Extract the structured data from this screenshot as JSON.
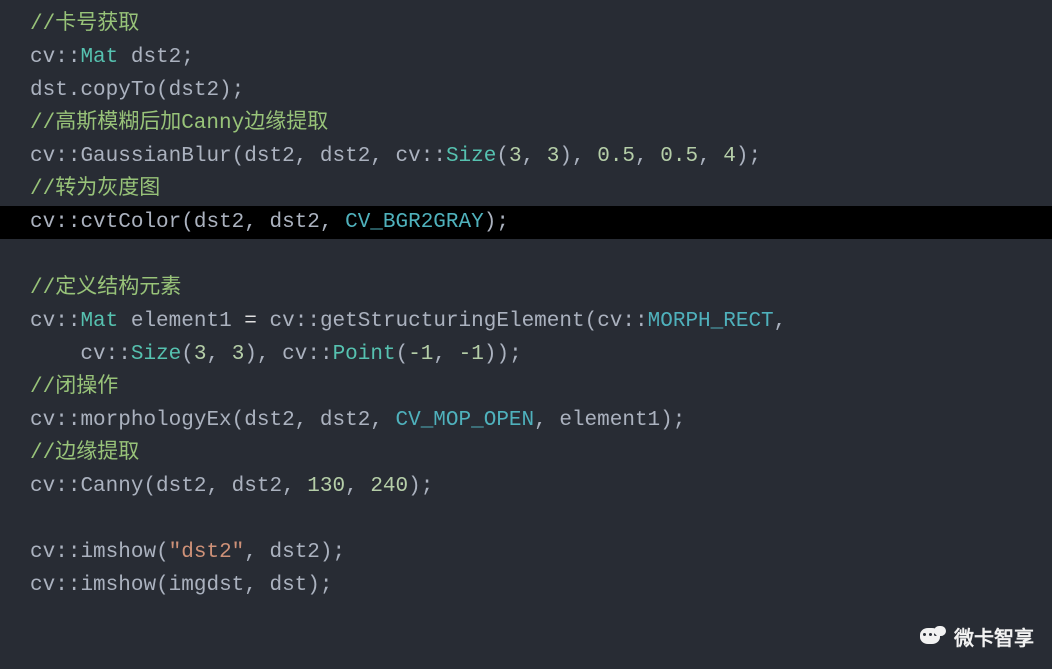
{
  "code": {
    "l1": {
      "c1": "//卡号获取"
    },
    "l2": {
      "ns": "cv",
      "sep": "::",
      "type": "Mat",
      "rest": " dst2;"
    },
    "l3": {
      "a": "dst.",
      "fn": "copyTo",
      "b": "(dst2);"
    },
    "l4": {
      "c1": "//高斯模糊后加Canny边缘提取"
    },
    "l5": {
      "ns": "cv",
      "sep": "::",
      "fn": "GaussianBlur",
      "a": "(dst2, dst2, ",
      "ns2": "cv",
      "sep2": "::",
      "sizefn": "Size",
      "b": "(",
      "n1": "3",
      "c": ", ",
      "n2": "3",
      "d": "), ",
      "n3": "0.5",
      "e": ", ",
      "n4": "0.5",
      "f": ", ",
      "n5": "4",
      "g": ");"
    },
    "l6": {
      "c1": "//转为灰度图"
    },
    "l7": {
      "ns": "cv",
      "sep": "::",
      "fn": "cvtColor",
      "a": "(dst2, dst2, ",
      "konst": "CV_BGR2GRAY",
      "b": ");"
    },
    "l8_blank": " ",
    "l9": {
      "c1": "//定义结构元素"
    },
    "l10": {
      "ns": "cv",
      "sep": "::",
      "type": "Mat",
      "a": " element1 ",
      "eq": "=",
      "b": " ",
      "ns2": "cv",
      "sep2": "::",
      "fn": "getStructuringElement",
      "c": "(",
      "ns3": "cv",
      "sep3": "::",
      "konst": "MORPH_RECT",
      "d": ","
    },
    "l11": {
      "indent": "    ",
      "ns": "cv",
      "sep": "::",
      "sizefn": "Size",
      "a": "(",
      "n1": "3",
      "b": ", ",
      "n2": "3",
      "c": "), ",
      "ns2": "cv",
      "sep2": "::",
      "ptfn": "Point",
      "d": "(",
      "n3": "-1",
      "e": ", ",
      "n4": "-1",
      "f": "));"
    },
    "l12": {
      "c1": "//闭操作"
    },
    "l13": {
      "ns": "cv",
      "sep": "::",
      "fn": "morphologyEx",
      "a": "(dst2, dst2, ",
      "konst": "CV_MOP_OPEN",
      "b": ", element1);"
    },
    "l14": {
      "c1": "//边缘提取"
    },
    "l15": {
      "ns": "cv",
      "sep": "::",
      "fn": "Canny",
      "a": "(dst2, dst2, ",
      "n1": "130",
      "b": ", ",
      "n2": "240",
      "c": ");"
    },
    "l16_blank": " ",
    "l17": {
      "ns": "cv",
      "sep": "::",
      "fn": "imshow",
      "a": "(",
      "str": "\"dst2\"",
      "b": ", dst2);"
    },
    "l18": {
      "ns": "cv",
      "sep": "::",
      "fn": "imshow",
      "a": "(imgdst, dst);"
    }
  },
  "watermark": {
    "text": "微卡智享"
  }
}
